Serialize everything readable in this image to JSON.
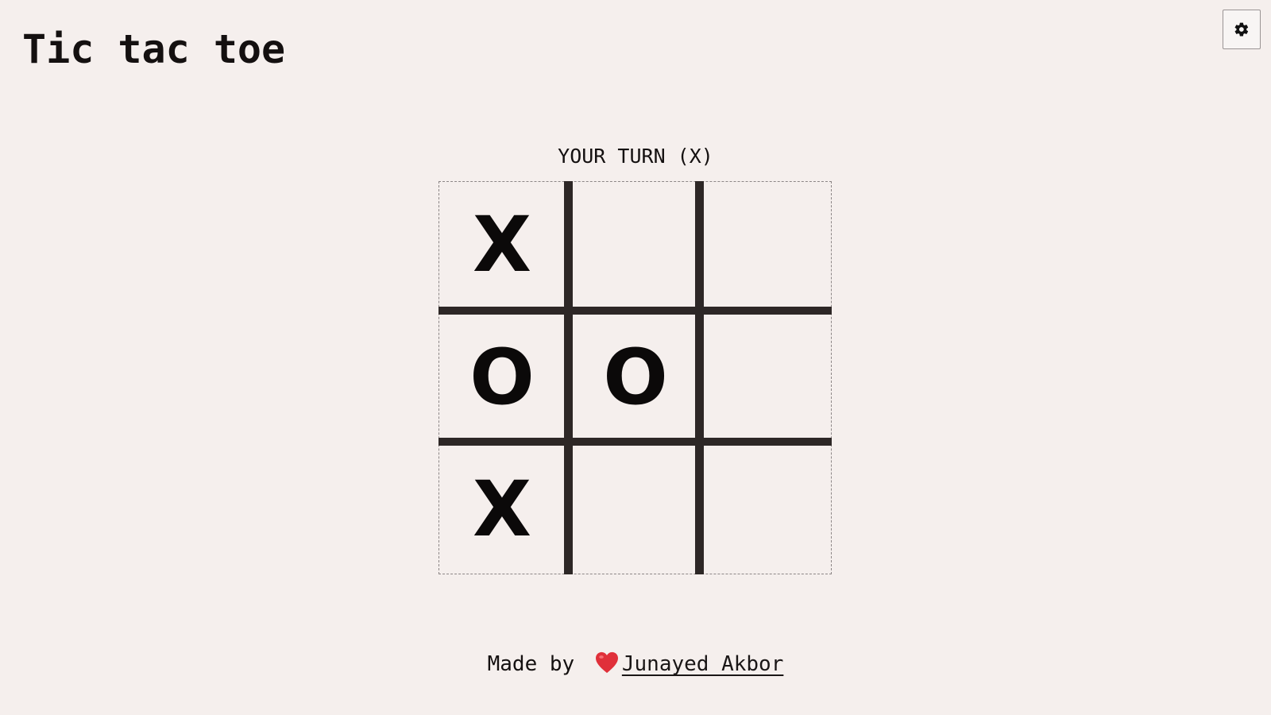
{
  "app": {
    "title": "Tic tac toe"
  },
  "toolbar": {
    "settings_icon": "gear-icon"
  },
  "game": {
    "status": "YOUR TURN (X)",
    "board": [
      [
        "X",
        "",
        ""
      ],
      [
        "O",
        "O",
        ""
      ],
      [
        "X",
        "",
        ""
      ]
    ]
  },
  "footer": {
    "made_by": "Made by",
    "heart_icon": "heart-icon",
    "author_link": "Junayed Akbor"
  },
  "colors": {
    "background": "#f5efed",
    "grid_lines": "#2d2726",
    "heart": "#e0303a"
  }
}
